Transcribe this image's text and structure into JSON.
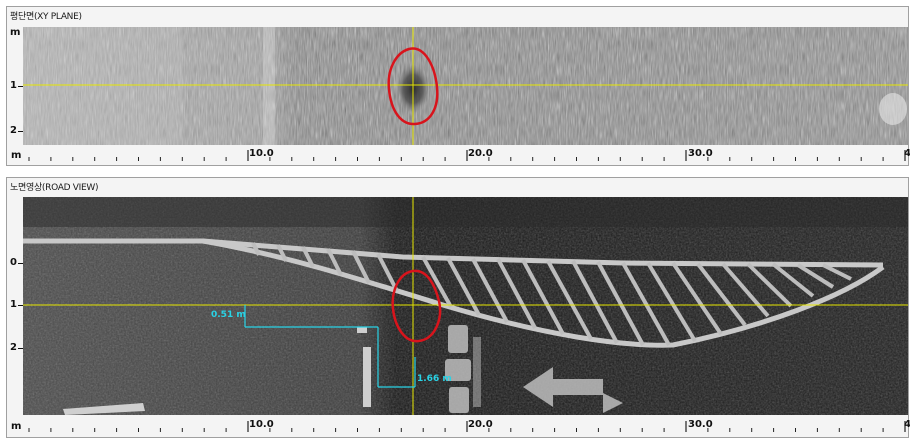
{
  "panels": {
    "xy_plane": {
      "title": "평단면(XY PLANE)",
      "y_unit": "m",
      "y_ticks": [
        "1",
        "2"
      ]
    },
    "road_view": {
      "title": "노면영상(ROAD VIEW)",
      "y_ticks": [
        "0",
        "1",
        "2"
      ]
    }
  },
  "ruler": {
    "unit": "m",
    "labels": [
      "10.0",
      "20.0",
      "30.0",
      "4"
    ]
  },
  "measurements": {
    "horizontal_offset": "0.51 m",
    "vertical_offset": "1.66 m"
  },
  "colors": {
    "crosshair": "#e6e600",
    "marker_circle": "#d8141c",
    "measure_line": "#29d3e6",
    "road_marking": "#c8c8c8"
  }
}
